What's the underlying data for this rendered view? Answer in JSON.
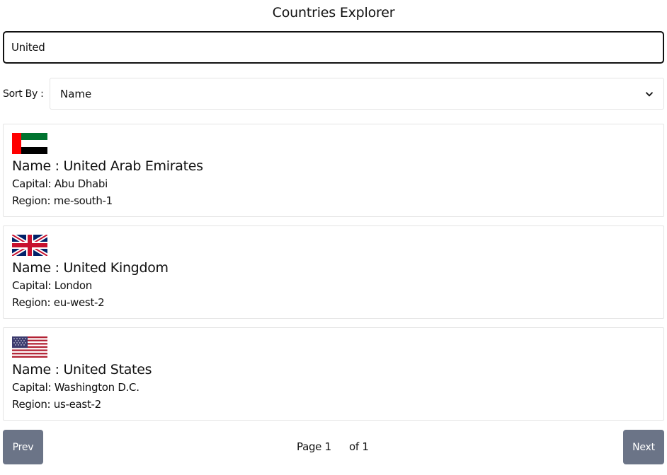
{
  "app": {
    "title": "Countries Explorer"
  },
  "search": {
    "value": "United"
  },
  "sort": {
    "label": "Sort By :",
    "selected": "Name"
  },
  "countries": [
    {
      "flag": "flag-uae-icon",
      "name_prefix": "Name : ",
      "name": "United Arab Emirates",
      "capital_prefix": "Capital: ",
      "capital": "Abu Dhabi",
      "region_prefix": "Region: ",
      "region": "me-south-1"
    },
    {
      "flag": "flag-uk-icon",
      "name_prefix": "Name : ",
      "name": "United Kingdom",
      "capital_prefix": "Capital: ",
      "capital": "London",
      "region_prefix": "Region: ",
      "region": "eu-west-2"
    },
    {
      "flag": "flag-us-icon",
      "name_prefix": "Name : ",
      "name": "United States",
      "capital_prefix": "Capital: ",
      "capital": "Washington D.C.",
      "region_prefix": "Region: ",
      "region": "us-east-2"
    }
  ],
  "pagination": {
    "prev_label": "Prev",
    "next_label": "Next",
    "page_text": "Page 1",
    "of_text": "of 1"
  },
  "colors": {
    "button": "#6b7487",
    "border": "#e4e4e4",
    "text": "#111111"
  }
}
